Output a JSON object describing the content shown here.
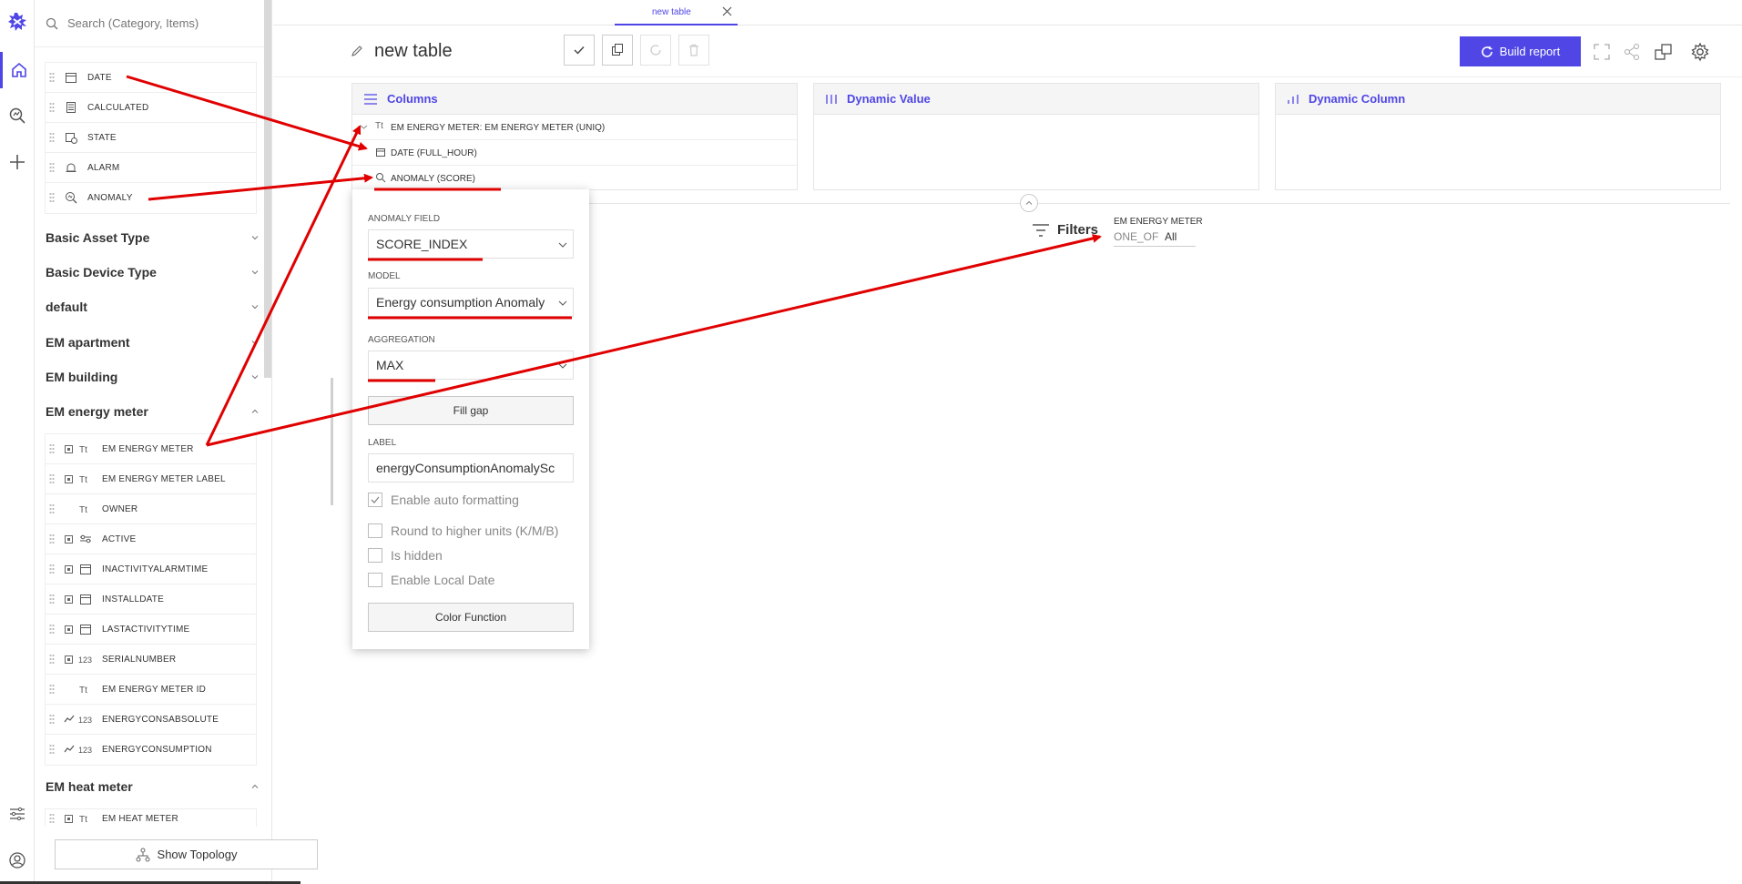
{
  "sidebar": {
    "search_placeholder": "Search (Category, Items)",
    "top_items": [
      {
        "label": "DATE",
        "icon": "calendar-icon"
      },
      {
        "label": "CALCULATED",
        "icon": "calculator-icon"
      },
      {
        "label": "STATE",
        "icon": "state-icon"
      },
      {
        "label": "ALARM",
        "icon": "alarm-icon"
      },
      {
        "label": "ANOMALY",
        "icon": "anomaly-icon"
      }
    ],
    "categories": [
      "Basic Asset Type",
      "Basic Device Type",
      "default",
      "EM apartment",
      "EM building",
      "EM energy meter",
      "EM heat meter"
    ],
    "energy_meter_items": [
      {
        "label": "EM ENERGY METER",
        "type": "Tt"
      },
      {
        "label": "EM ENERGY METER LABEL",
        "type": "Tt"
      },
      {
        "label": "OWNER",
        "type": "Tt"
      },
      {
        "label": "ACTIVE",
        "type": "toggle"
      },
      {
        "label": "INACTIVITYALARMTIME",
        "type": "calendar"
      },
      {
        "label": "INSTALLDATE",
        "type": "calendar"
      },
      {
        "label": "LASTACTIVITYTIME",
        "type": "calendar"
      },
      {
        "label": "SERIALNUMBER",
        "type": "123"
      },
      {
        "label": "EM ENERGY METER ID",
        "type": "Tt"
      },
      {
        "label": "ENERGYCONSABSOLUTE",
        "type": "123"
      },
      {
        "label": "ENERGYCONSUMPTION",
        "type": "123"
      }
    ],
    "heat_meter_items": [
      {
        "label": "EM HEAT METER",
        "type": "Tt"
      }
    ],
    "show_topology": "Show Topology",
    "type_labels": {
      "text": "Tt",
      "number": "123"
    }
  },
  "tab": {
    "label": "new table"
  },
  "toolbar": {
    "title": "new table",
    "build_report": "Build report"
  },
  "panels": {
    "columns": {
      "title": "Columns",
      "rows": [
        "EM ENERGY METER: EM ENERGY METER (UNIQ)",
        "DATE (FULL_HOUR)",
        "ANOMALY (SCORE)"
      ],
      "row_type_label": "Tt"
    },
    "dynamic_value": {
      "title": "Dynamic Value"
    },
    "dynamic_column": {
      "title": "Dynamic Column"
    }
  },
  "filters": {
    "title": "Filters",
    "chip_name": "EM ENERGY METER",
    "chip_op": "ONE_OF",
    "chip_value": "All"
  },
  "popup": {
    "anomaly_field_label": "ANOMALY FIELD",
    "anomaly_field_value": "SCORE_INDEX",
    "model_label": "MODEL",
    "model_value": "Energy consumption Anomaly",
    "aggregation_label": "AGGREGATION",
    "aggregation_value": "MAX",
    "fill_gap": "Fill gap",
    "label_label": "LABEL",
    "label_value": "energyConsumptionAnomalySc",
    "checkboxes": [
      {
        "label": "Enable auto formatting",
        "checked": true
      },
      {
        "label": "Round to higher units (K/M/B)",
        "checked": false
      },
      {
        "label": "Is hidden",
        "checked": false
      },
      {
        "label": "Enable Local Date",
        "checked": false
      }
    ],
    "color_function": "Color Function"
  },
  "colors": {
    "accent": "#4f46e5",
    "annotation": "#e00000"
  }
}
